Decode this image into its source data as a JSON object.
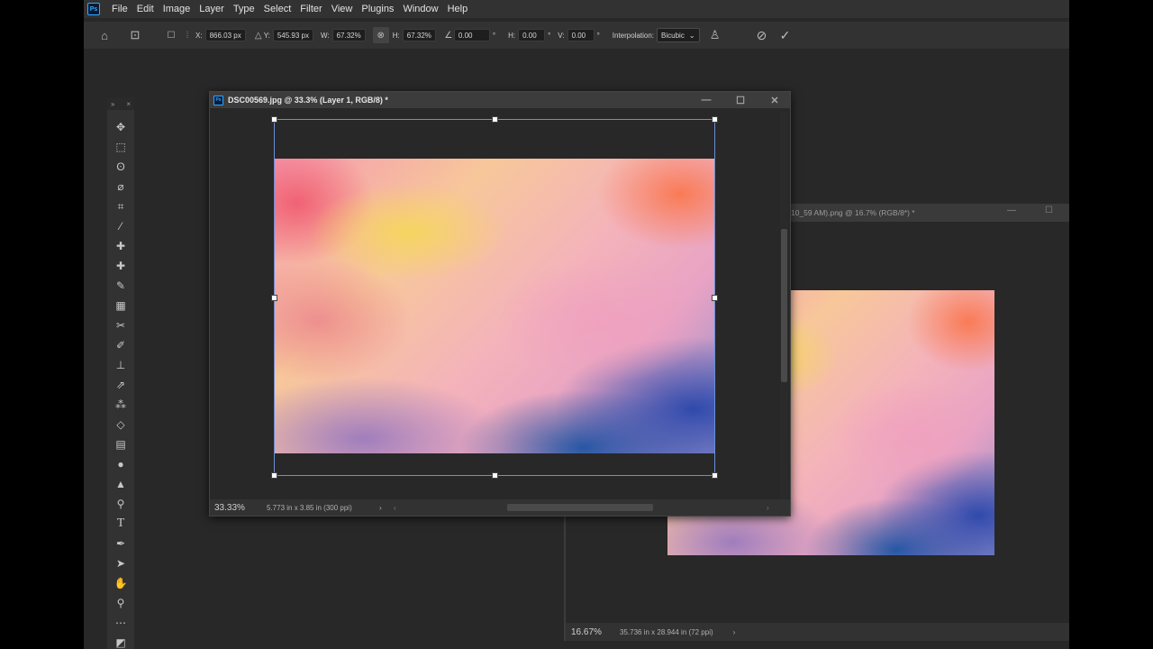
{
  "menu": {
    "logo": "Ps",
    "items": [
      "File",
      "Edit",
      "Image",
      "Layer",
      "Type",
      "Select",
      "Filter",
      "View",
      "Plugins",
      "Window",
      "Help"
    ]
  },
  "options": {
    "x_label": "X:",
    "x_value": "866.03 px",
    "y_label": "Y:",
    "y_value": "545.93 px",
    "w_label": "W:",
    "w_value": "67.32%",
    "h_label": "H:",
    "h_value": "67.32%",
    "angle_value": "0.00",
    "deg_symbol": "°",
    "hskew_label": "H:",
    "hskew_value": "0.00",
    "vskew_label": "V:",
    "vskew_value": "0.00",
    "interp_label": "Interpolation:",
    "interp_value": "Bicubic"
  },
  "toolbar": {
    "collapse": "»",
    "close": "×",
    "tools": [
      "move-tool",
      "marquee-tool",
      "lasso-tool",
      "quick-select-tool",
      "crop-tool",
      "eyedropper-tool",
      "spot-healing-tool",
      "healing-brush-tool",
      "patch-tool",
      "content-aware-tool",
      "red-eye-tool",
      "brush-tool",
      "clone-stamp-tool",
      "history-brush-tool",
      "pattern-tool",
      "eraser-tool",
      "gradient-tool",
      "blur-tool",
      "sharpen-tool",
      "dodge-tool",
      "type-tool",
      "pen-tool",
      "path-select-tool",
      "hand-tool",
      "zoom-tool",
      "more-tools"
    ]
  },
  "doc1": {
    "icon": "Ps",
    "title": "DSC00569.jpg @ 33.3% (Layer 1, RGB/8) *",
    "zoom": "33.33%",
    "info": "5.773 in x 3.85 in (300 ppi)"
  },
  "doc2": {
    "title": "10_59 AM).png @ 16.7% (RGB/8*) *",
    "zoom": "16.67%",
    "info": "35.736 in x 28.944 in (72 ppi)"
  }
}
